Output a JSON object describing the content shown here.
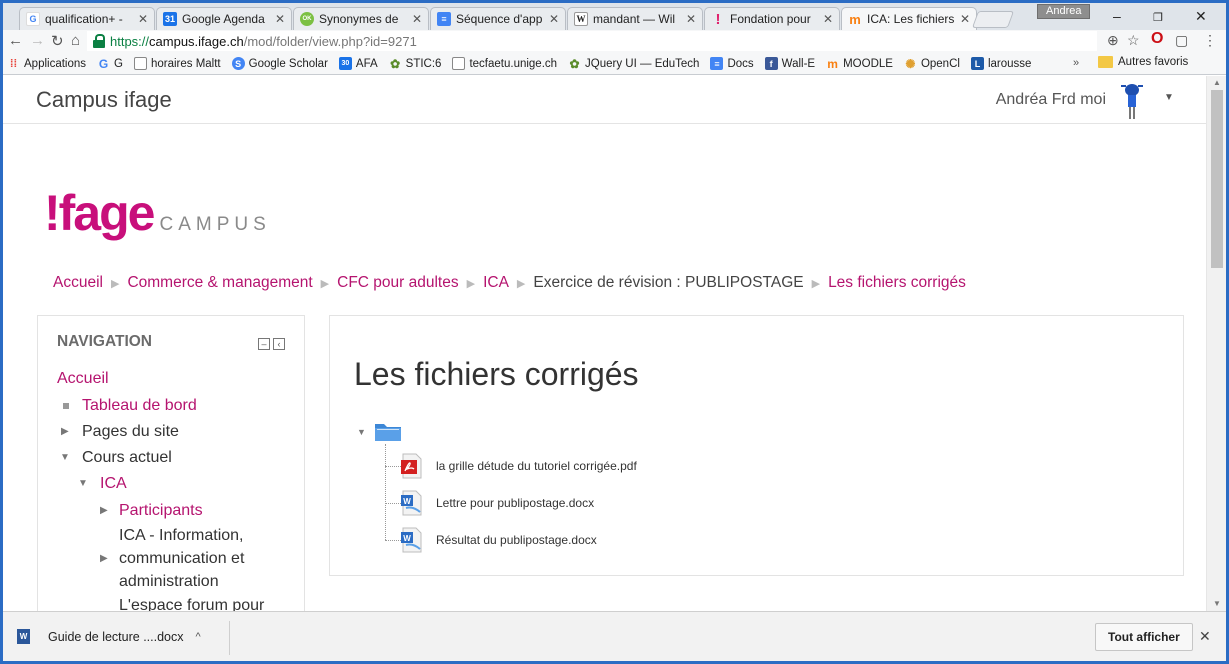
{
  "browser": {
    "tabs": [
      {
        "label": "qualification+ -",
        "icon": "google-icon",
        "color": "#4285f4",
        "glyph": "G"
      },
      {
        "label": "Google Agenda",
        "icon": "calendar-icon",
        "color": "#1a73e8",
        "glyph": "31"
      },
      {
        "label": "Synonymes de",
        "icon": "synonymes-icon",
        "color": "#7cc043",
        "glyph": "OK"
      },
      {
        "label": "Séquence d'app",
        "icon": "docs-icon",
        "color": "#4285f4",
        "glyph": "≡"
      },
      {
        "label": "mandant — Wil",
        "icon": "wikipedia-icon",
        "color": "#ffffff",
        "glyph": "W"
      },
      {
        "label": "Fondation pour",
        "icon": "exclamation-icon",
        "color": "#e0226e",
        "glyph": "!"
      },
      {
        "label": "ICA: Les fichiers",
        "icon": "moodle-icon",
        "color": "#f98012",
        "glyph": "m"
      }
    ],
    "profile": "Andrea",
    "url": {
      "scheme": "https://",
      "host": "campus.ifage.ch",
      "path": "/mod/folder/view.php?id=9271"
    },
    "bookmarks": [
      {
        "label": "Applications",
        "icon": "apps-grid-icon",
        "color": "#e8453c",
        "glyph": "⁞⁞"
      },
      {
        "label": "G",
        "icon": "google-icon",
        "color": "#4285f4",
        "glyph": "G"
      },
      {
        "label": "horaires Maltt",
        "icon": "page-icon",
        "color": "#ffffff",
        "glyph": ""
      },
      {
        "label": "Google Scholar",
        "icon": "scholar-icon",
        "color": "#4285f4",
        "glyph": "S"
      },
      {
        "label": "AFA",
        "icon": "calendar-icon",
        "color": "#1a73e8",
        "glyph": "30"
      },
      {
        "label": "STIC:6",
        "icon": "edutech-icon",
        "color": "#5b8c2a",
        "glyph": "✿"
      },
      {
        "label": "tecfaetu.unige.ch",
        "icon": "page-icon",
        "color": "#ffffff",
        "glyph": ""
      },
      {
        "label": "JQuery UI — EduTech",
        "icon": "edutech-icon",
        "color": "#5b8c2a",
        "glyph": "✿"
      },
      {
        "label": "Docs",
        "icon": "docs-icon",
        "color": "#4285f4",
        "glyph": "≡"
      },
      {
        "label": "Wall-E",
        "icon": "facebook-icon",
        "color": "#3b5998",
        "glyph": "f"
      },
      {
        "label": "MOODLE",
        "icon": "moodle-icon",
        "color": "#f98012",
        "glyph": "m"
      },
      {
        "label": "OpenCl",
        "icon": "opencl-icon",
        "color": "#e0a030",
        "glyph": "✺"
      },
      {
        "label": "larousse",
        "icon": "larousse-icon",
        "color": "#1d5aa8",
        "glyph": "L"
      }
    ],
    "bookmarks_more": "»",
    "other_bookmarks": "Autres favoris"
  },
  "site": {
    "brand": "Campus ifage",
    "user": "Andréa Frd moi",
    "logo_main": "!fage",
    "logo_sub": "CAMPUS"
  },
  "breadcrumb": [
    {
      "label": "Accueil",
      "link": true
    },
    {
      "label": "Commerce & management",
      "link": true
    },
    {
      "label": "CFC pour adultes",
      "link": true
    },
    {
      "label": "ICA",
      "link": true
    },
    {
      "label": "Exercice de révision : PUBLIPOSTAGE",
      "link": false
    },
    {
      "label": "Les fichiers corrigés",
      "link": true
    }
  ],
  "navigation": {
    "title": "NAVIGATION",
    "home": "Accueil",
    "dashboard": "Tableau de bord",
    "site_pages": "Pages du site",
    "current_course": "Cours actuel",
    "course": "ICA",
    "participants": "Participants",
    "section1": [
      "ICA - Information,",
      "communication et",
      "administration"
    ],
    "section2_partial": "L'espace forum pour"
  },
  "main": {
    "title": "Les fichiers corrigés",
    "files": [
      {
        "name": "la grille détude du tutoriel corrigée.pdf",
        "type": "pdf"
      },
      {
        "name": "Lettre pour publipostage.docx",
        "type": "docx"
      },
      {
        "name": "Résultat du publipostage.docx",
        "type": "docx"
      }
    ]
  },
  "downloads": {
    "item": "Guide de lecture ....docx",
    "show_all": "Tout afficher"
  },
  "colors": {
    "accent": "#b5146f",
    "logo": "#c80f7b",
    "secure": "#0b8043"
  }
}
